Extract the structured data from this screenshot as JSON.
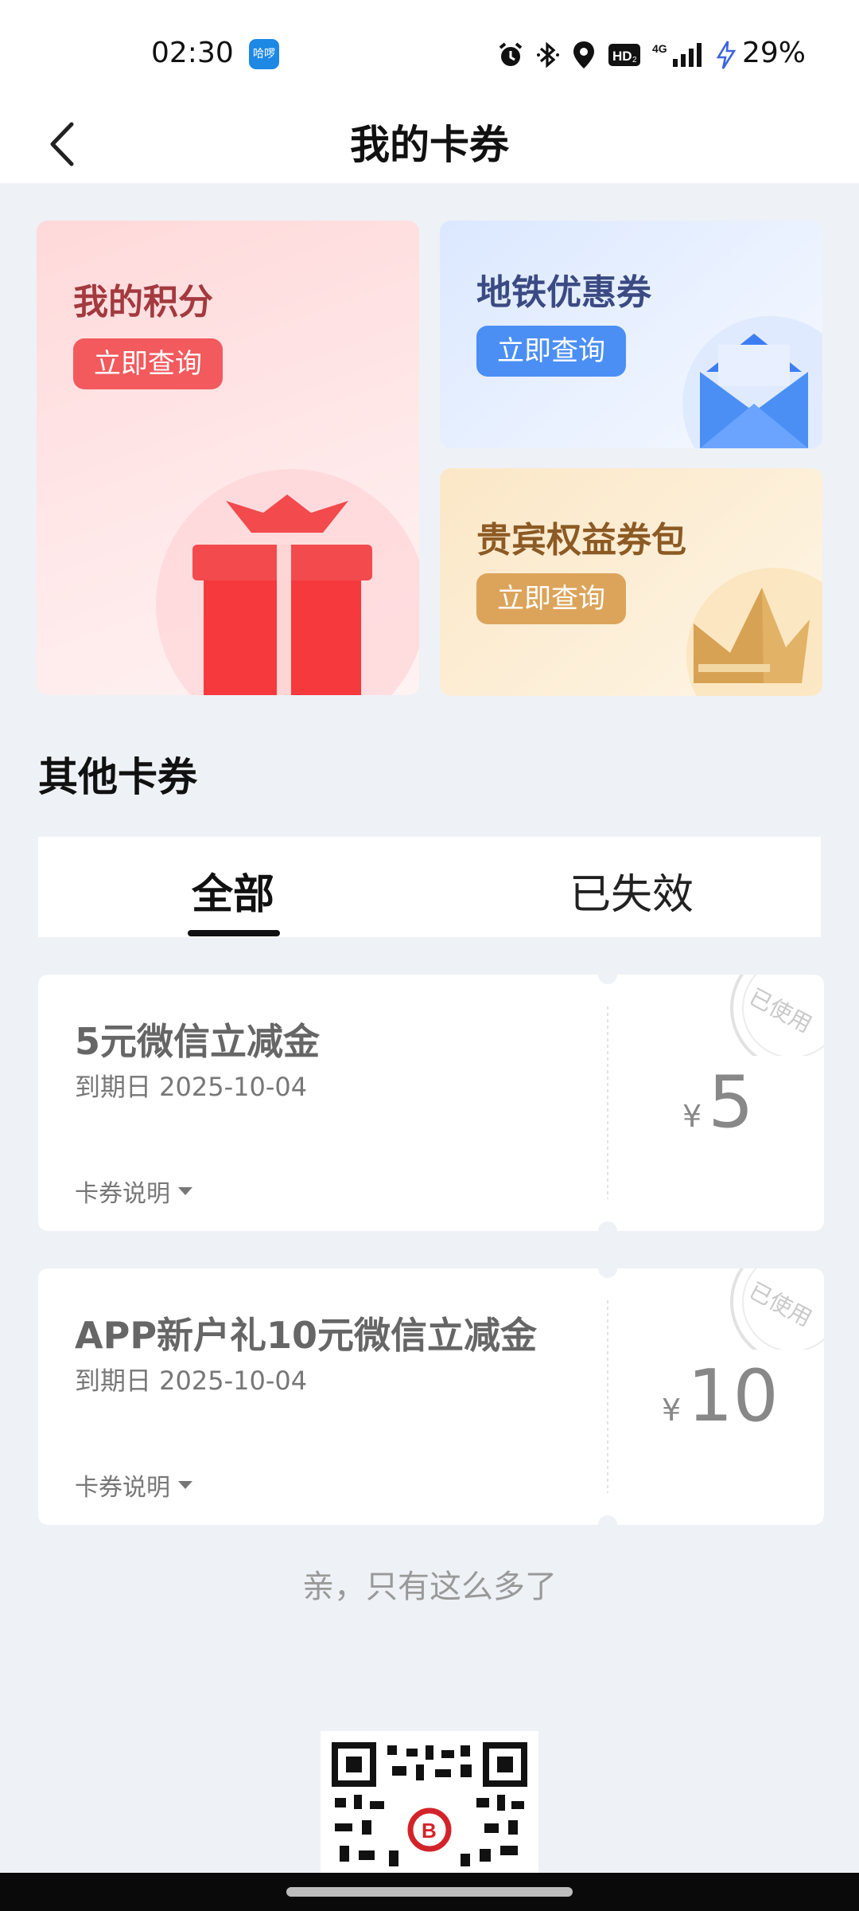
{
  "status_bar": {
    "time": "02:30",
    "app_badge": "哈啰",
    "battery": "29%"
  },
  "header": {
    "title": "我的卡券"
  },
  "cards": {
    "points": {
      "title": "我的积分",
      "button": "立即查询"
    },
    "metro": {
      "title": "地铁优惠券",
      "button": "立即查询"
    },
    "vip": {
      "title": "贵宾权益券包",
      "button": "立即查询"
    }
  },
  "section": {
    "title": "其他卡券"
  },
  "tabs": [
    {
      "label": "全部",
      "active": true
    },
    {
      "label": "已失效",
      "active": false
    }
  ],
  "coupons": [
    {
      "name": "5元微信立减金",
      "expire": "到期日 2025-10-04",
      "desc": "卡券说明",
      "currency": "¥",
      "amount": "5",
      "stamp": "已使用"
    },
    {
      "name": "APP新户礼10元微信立减金",
      "expire": "到期日 2025-10-04",
      "desc": "卡券说明",
      "currency": "¥",
      "amount": "10",
      "stamp": "已使用"
    }
  ],
  "end_note": "亲，只有这么多了",
  "colors": {
    "points_title": "#a33a3f",
    "points_button": "#f25a5d",
    "metro_title": "#3b4a82",
    "metro_button": "#4b8ff5",
    "vip_title": "#8c5a24",
    "vip_button": "#dca45a"
  }
}
